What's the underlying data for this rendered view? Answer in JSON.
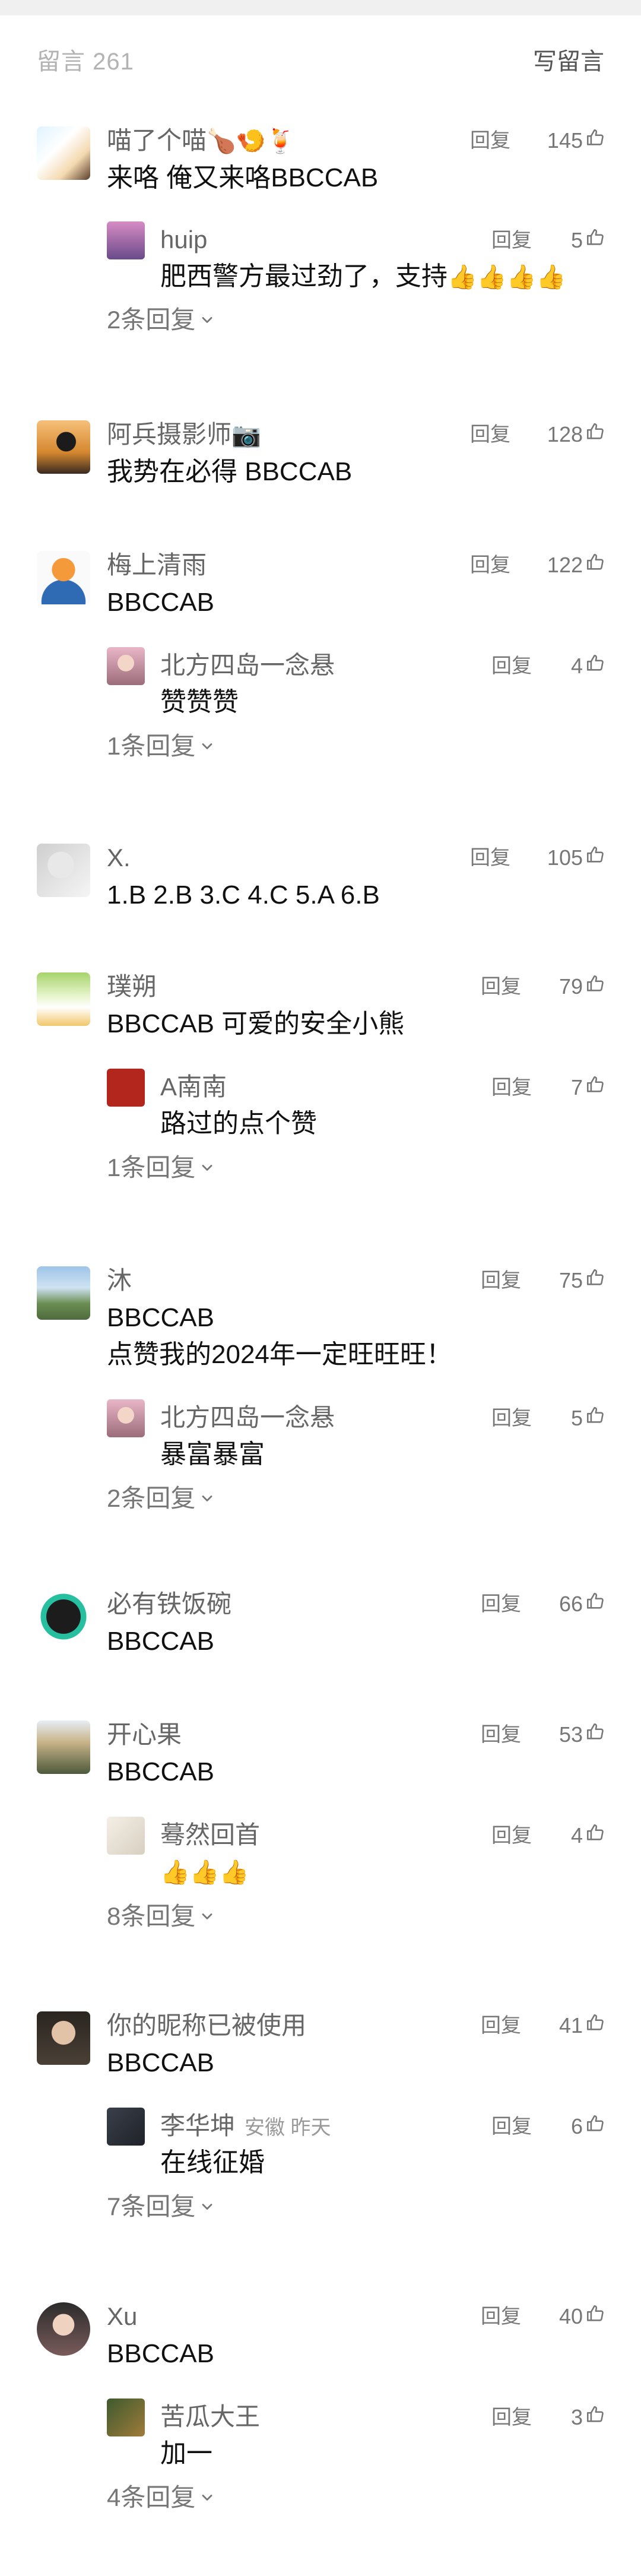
{
  "header": {
    "count_label": "留言 261",
    "write_label": "写留言"
  },
  "reply_label": "回复",
  "comments": [
    {
      "name": "喵了个喵",
      "name_emoji": [
        "🍗",
        "🍤",
        "🍹"
      ],
      "likes": "145",
      "text": "来咯 俺又来咯BBCCAB",
      "reply": {
        "name": "huip",
        "likes": "5",
        "text": "肥西警方最过劲了，支持",
        "text_emoji": [
          "👍",
          "👍",
          "👍",
          "👍"
        ]
      },
      "more": "2条回复"
    },
    {
      "name": "阿兵摄影师",
      "name_emoji": [
        "📷"
      ],
      "likes": "128",
      "text": "我势在必得 BBCCAB"
    },
    {
      "name": "梅上清雨",
      "likes": "122",
      "text": "BBCCAB",
      "reply": {
        "name": "北方四岛一念悬",
        "likes": "4",
        "text": "赞赞赞"
      },
      "more": "1条回复"
    },
    {
      "name": "X.",
      "likes": "105",
      "text": "1.B 2.B 3.C 4.C 5.A 6.B"
    },
    {
      "name": "璞朔",
      "likes": "79",
      "text": "BBCCAB   可爱的安全小熊",
      "reply": {
        "name": "A南南",
        "likes": "7",
        "text": "路过的点个赞"
      },
      "more": "1条回复"
    },
    {
      "name": "沐",
      "likes": "75",
      "text": "BBCCAB\n点赞我的2024年一定旺旺旺！",
      "reply": {
        "name": "北方四岛一念悬",
        "likes": "5",
        "text": "暴富暴富"
      },
      "more": "2条回复"
    },
    {
      "name": "必有铁饭碗",
      "likes": "66",
      "text": "BBCCAB"
    },
    {
      "name": "开心果",
      "likes": "53",
      "text": "BBCCAB",
      "reply": {
        "name": "蓦然回首",
        "likes": "4",
        "text": "",
        "text_emoji": [
          "👍",
          "👍",
          "👍"
        ]
      },
      "more": "8条回复"
    },
    {
      "name": "你的昵称已被使用",
      "likes": "41",
      "text": "BBCCAB",
      "reply": {
        "name": "李华坤",
        "sub": "安徽 昨天",
        "likes": "6",
        "text": "在线征婚"
      },
      "more": "7条回复"
    },
    {
      "name": "Xu",
      "likes": "40",
      "text": "BBCCAB",
      "reply": {
        "name": "苦瓜大王",
        "likes": "3",
        "text": "加一"
      },
      "more": "4条回复"
    }
  ],
  "colors": {
    "muted": "#777777",
    "name": "#666666",
    "text": "#111111",
    "count": "#b3b3b3"
  },
  "icons": {
    "like": "thumbs-up-icon",
    "expand": "chevron-down-icon"
  }
}
